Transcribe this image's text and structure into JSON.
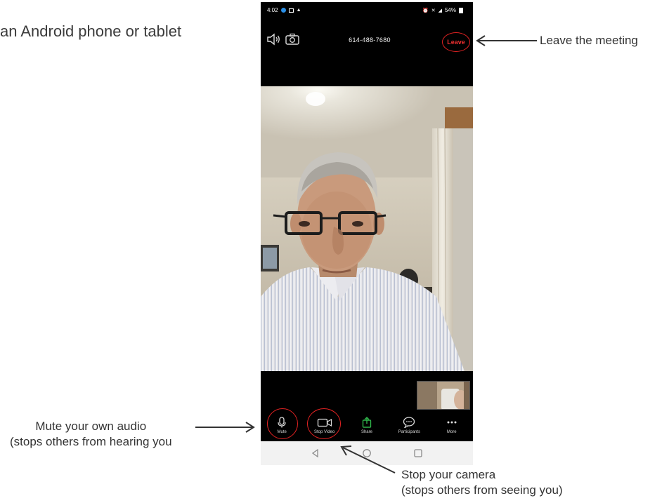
{
  "heading": "an Android phone or tablet",
  "annotations": {
    "leave": "Leave the meeting",
    "mute_line1": "Mute your own audio",
    "mute_line2": "(stops others from hearing you",
    "video_line1": "Stop your camera",
    "video_line2": "(stops others from seeing you)"
  },
  "phone": {
    "status": {
      "time": "4:02",
      "battery": "54%"
    },
    "meeting_id": "614-488-7680",
    "leave_label": "Leave",
    "toolbar": [
      {
        "label": "Mute",
        "icon": "microphone-icon"
      },
      {
        "label": "Stop Video",
        "icon": "video-camera-icon"
      },
      {
        "label": "Share",
        "icon": "share-icon"
      },
      {
        "label": "Participants",
        "icon": "participants-icon"
      },
      {
        "label": "More",
        "icon": "more-icon"
      }
    ],
    "nav": [
      "back-icon",
      "home-icon",
      "recents-icon"
    ]
  },
  "colors": {
    "highlight_ring": "#e12222",
    "phone_bg": "#000000",
    "share_green": "#2fb34a"
  }
}
